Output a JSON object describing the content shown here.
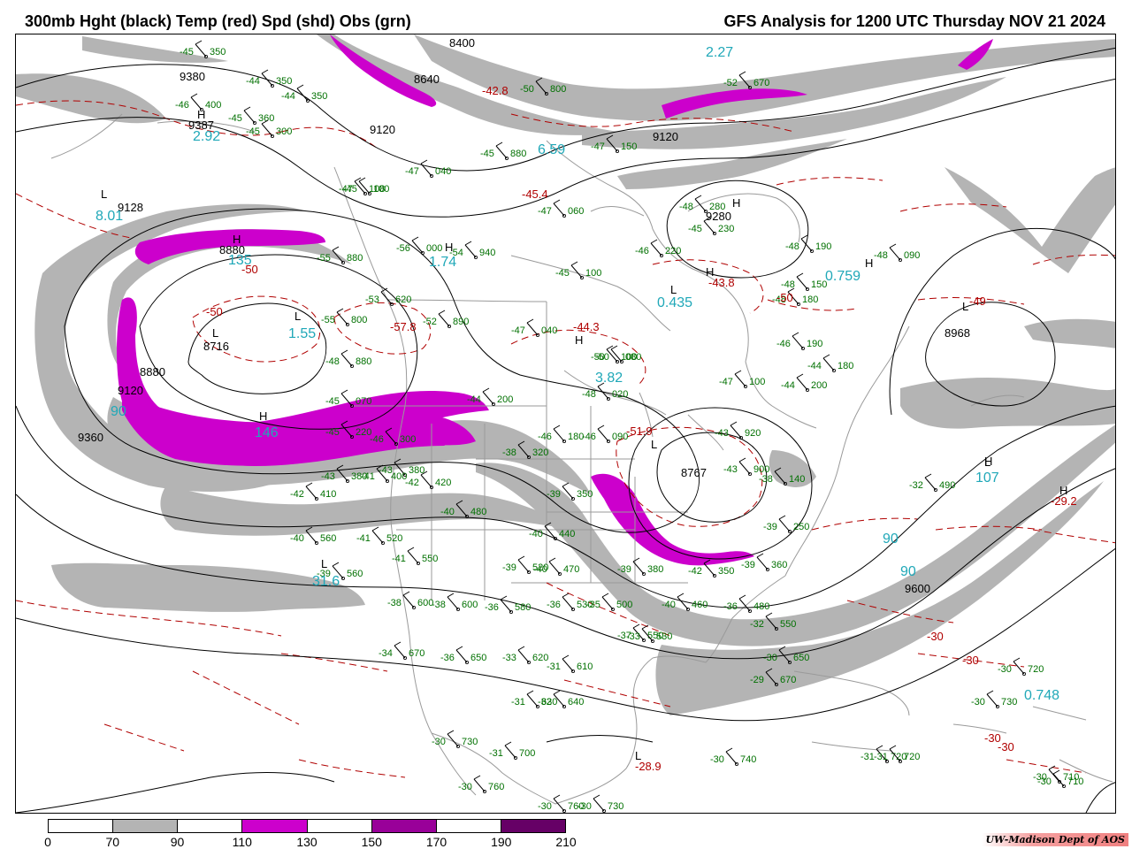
{
  "header": {
    "title_left": "300mb Hght (black) Temp (red) Spd (shd) Obs (grn)",
    "title_right": "GFS Analysis for 1200 UTC Thursday  NOV 21 2024"
  },
  "legend": {
    "ticks": [
      "0",
      "70",
      "90",
      "110",
      "130",
      "150",
      "170",
      "190",
      "210"
    ],
    "colors": [
      "#ffffff",
      "#b4b4b4",
      "#ffffff",
      "#cc00cc",
      "#ffffff",
      "#990099",
      "#ffffff",
      "#660066"
    ]
  },
  "colors": {
    "height_contour": "#000000",
    "temp_contour": "#b00000",
    "speed_label": "#20a8b8",
    "obs": "#007000",
    "map_lines": "#9a9a9a",
    "shade_70": "#b4b4b4",
    "shade_110": "#cc00cc"
  },
  "height_labels": [
    "8400",
    "8640",
    "9380",
    "9387",
    "9120",
    "9120",
    "9128",
    "8880",
    "8716",
    "8880",
    "9120",
    "9360",
    "9280",
    "8968",
    "8767",
    "9600"
  ],
  "temp_labels": [
    "-42.8",
    "-45.4",
    "-50",
    "-50",
    "-57.8",
    "-44.3",
    "-43.8",
    "-50",
    "-49",
    "-51.9",
    "-29.2",
    "-28.9",
    "-30",
    "-30",
    "-30",
    "-30"
  ],
  "center_markers": [
    "L",
    "H",
    "H",
    "L",
    "H",
    "L",
    "H",
    "L",
    "H",
    "L",
    "H",
    "L",
    "L",
    "H",
    "H",
    "L",
    "H",
    "H",
    "L"
  ],
  "speed_labels": [
    "2.27",
    "2.92",
    "8.01",
    "6.59",
    "135",
    "1.74",
    "1.55",
    "146",
    "3.82",
    "0.435",
    "0.759",
    "107",
    "31.6",
    "90",
    "90",
    "0.748",
    "90"
  ],
  "obs": [
    {
      "t": "-45",
      "h": "350"
    },
    {
      "t": "-44",
      "h": "350"
    },
    {
      "t": "-44",
      "h": "350"
    },
    {
      "t": "-46",
      "h": "400"
    },
    {
      "t": "-45",
      "h": "360"
    },
    {
      "t": "-45",
      "h": "300"
    },
    {
      "t": "-45",
      "h": "100"
    },
    {
      "t": "-47",
      "h": "040"
    },
    {
      "t": "-47",
      "h": "108"
    },
    {
      "t": "-47",
      "h": "060"
    },
    {
      "t": "-46",
      "h": "220"
    },
    {
      "t": "-45",
      "h": "230"
    },
    {
      "t": "-48",
      "h": "190"
    },
    {
      "t": "-48",
      "h": "090"
    },
    {
      "t": "-55",
      "h": "880"
    },
    {
      "t": "-56",
      "h": "000"
    },
    {
      "t": "-54",
      "h": "940"
    },
    {
      "t": "-53",
      "h": "620"
    },
    {
      "t": "-55",
      "h": "800"
    },
    {
      "t": "-52",
      "h": "890"
    },
    {
      "t": "-47",
      "h": "040"
    },
    {
      "t": "-45",
      "h": "100"
    },
    {
      "t": "-50",
      "h": "080"
    },
    {
      "t": "-48",
      "h": "020"
    },
    {
      "t": "-47",
      "h": "100"
    },
    {
      "t": "-44",
      "h": "200"
    },
    {
      "t": "-46",
      "h": "190"
    },
    {
      "t": "-44",
      "h": "180"
    },
    {
      "t": "-48",
      "h": "150"
    },
    {
      "t": "-48",
      "h": "180"
    },
    {
      "t": "-48",
      "h": "880"
    },
    {
      "t": "-45",
      "h": "070"
    },
    {
      "t": "-44",
      "h": "200"
    },
    {
      "t": "-45",
      "h": "220"
    },
    {
      "t": "-46",
      "h": "300"
    },
    {
      "t": "-43",
      "h": "380"
    },
    {
      "t": "-42",
      "h": "410"
    },
    {
      "t": "-43",
      "h": "380"
    },
    {
      "t": "-41",
      "h": "400"
    },
    {
      "t": "-42",
      "h": "420"
    },
    {
      "t": "-40",
      "h": "480"
    },
    {
      "t": "-38",
      "h": "320"
    },
    {
      "t": "-46",
      "h": "180"
    },
    {
      "t": "-46",
      "h": "090"
    },
    {
      "t": "-43",
      "h": "900"
    },
    {
      "t": "-43",
      "h": "920"
    },
    {
      "t": "-40",
      "h": "560"
    },
    {
      "t": "-41",
      "h": "520"
    },
    {
      "t": "-41",
      "h": "550"
    },
    {
      "t": "-39",
      "h": "560"
    },
    {
      "t": "-39",
      "h": "520"
    },
    {
      "t": "-40",
      "h": "470"
    },
    {
      "t": "-40",
      "h": "440"
    },
    {
      "t": "-39",
      "h": "350"
    },
    {
      "t": "-38",
      "h": "600"
    },
    {
      "t": "-38",
      "h": "600"
    },
    {
      "t": "-36",
      "h": "580"
    },
    {
      "t": "-36",
      "h": "530"
    },
    {
      "t": "-35",
      "h": "500"
    },
    {
      "t": "-37",
      "h": "550"
    },
    {
      "t": "-33",
      "h": "530"
    },
    {
      "t": "-40",
      "h": "460"
    },
    {
      "t": "-39",
      "h": "380"
    },
    {
      "t": "-42",
      "h": "350"
    },
    {
      "t": "-39",
      "h": "360"
    },
    {
      "t": "-39",
      "h": "250"
    },
    {
      "t": "-38",
      "h": "140"
    },
    {
      "t": "-32",
      "h": "490"
    },
    {
      "t": "-36",
      "h": "480"
    },
    {
      "t": "-32",
      "h": "550"
    },
    {
      "t": "-30",
      "h": "650"
    },
    {
      "t": "-29",
      "h": "670"
    },
    {
      "t": "-34",
      "h": "670"
    },
    {
      "t": "-36",
      "h": "650"
    },
    {
      "t": "-33",
      "h": "620"
    },
    {
      "t": "-31",
      "h": "610"
    },
    {
      "t": "-31",
      "h": "630"
    },
    {
      "t": "-32",
      "h": "640"
    },
    {
      "t": "-31",
      "h": "720"
    },
    {
      "t": "-31",
      "h": "700"
    },
    {
      "t": "-30",
      "h": "730"
    },
    {
      "t": "-30",
      "h": "740"
    },
    {
      "t": "-31",
      "h": "720"
    },
    {
      "t": "-30",
      "h": "720"
    },
    {
      "t": "-30",
      "h": "710"
    },
    {
      "t": "-30",
      "h": "730"
    },
    {
      "t": "-30",
      "h": "760"
    },
    {
      "t": "-30",
      "h": "760"
    },
    {
      "t": "-30",
      "h": "730"
    },
    {
      "t": "-30",
      "h": "710"
    },
    {
      "t": "-50",
      "h": "100"
    },
    {
      "t": "-52",
      "h": "670"
    },
    {
      "t": "-48",
      "h": "280"
    },
    {
      "t": "-45",
      "h": "880"
    },
    {
      "t": "-47",
      "h": "150"
    },
    {
      "t": "-50",
      "h": "800"
    }
  ],
  "credit": "UW-Madison  Dept of AOS"
}
